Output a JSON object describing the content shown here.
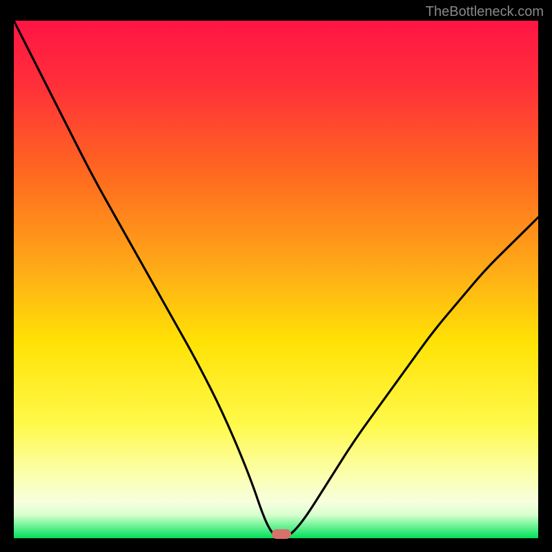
{
  "attribution": "TheBottleneck.com",
  "colors": {
    "top": "#ff1744",
    "mid_upper": "#ff7a1a",
    "mid": "#ffe600",
    "mid_lower": "#f7ff7a",
    "pale": "#fbffd6",
    "green": "#00e676",
    "curve": "#000000",
    "marker": "#d9706b"
  },
  "chart_data": {
    "type": "line",
    "title": "",
    "xlabel": "",
    "ylabel": "",
    "xlim": [
      0,
      100
    ],
    "ylim": [
      0,
      100
    ],
    "x": [
      0,
      5,
      10,
      15,
      20,
      25,
      30,
      35,
      40,
      45,
      48,
      50,
      52,
      55,
      60,
      65,
      70,
      75,
      80,
      85,
      90,
      95,
      100
    ],
    "y": [
      100,
      90,
      80,
      70,
      61,
      52,
      43,
      34,
      24,
      12,
      3,
      0,
      0,
      3,
      11,
      19,
      26,
      33,
      40,
      46,
      52,
      57,
      62
    ],
    "minimum_x": 51,
    "minimum_y": 0,
    "annotations": []
  }
}
